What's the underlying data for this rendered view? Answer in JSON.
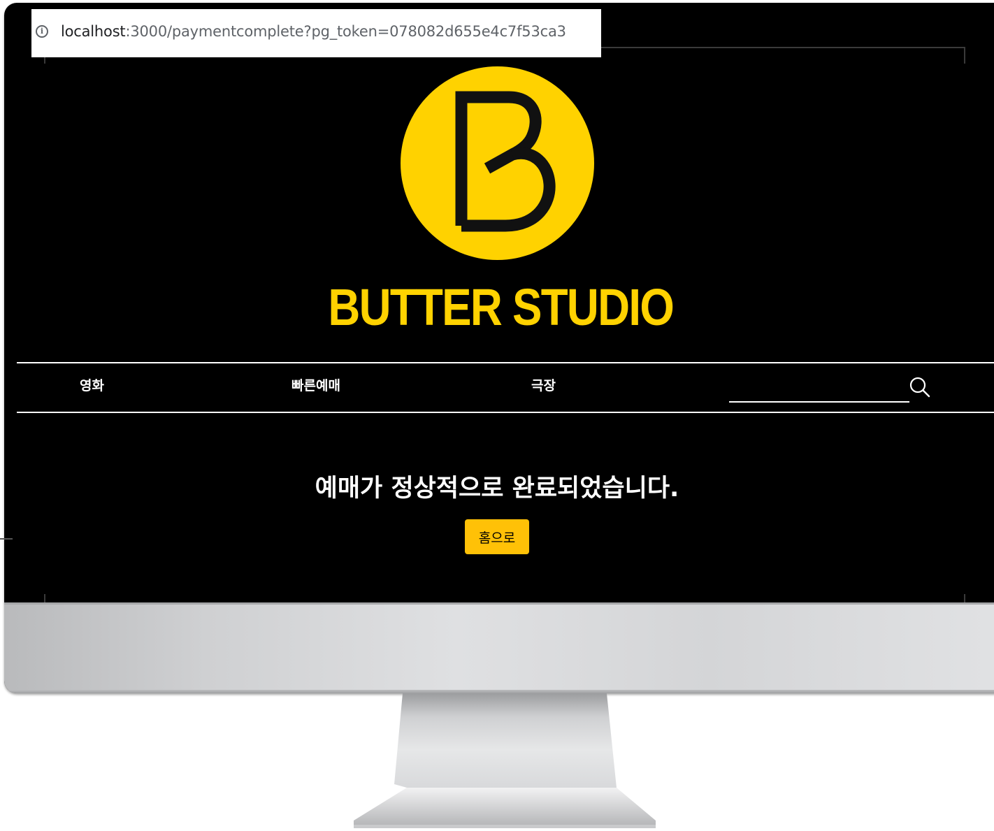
{
  "browser": {
    "url_host": "localhost",
    "url_rest": ":3000/paymentcomplete?pg_token=078082d655e4c7f53ca3"
  },
  "header": {
    "brand": "BUTTER STUDIO",
    "logo_letter": "B"
  },
  "nav": {
    "items": [
      {
        "label": "영화"
      },
      {
        "label": "빠른예매"
      },
      {
        "label": "극장"
      }
    ],
    "search_placeholder": ""
  },
  "main": {
    "message": "예매가 정상적으로 완료되었습니다.",
    "home_button": "홈으로"
  },
  "colors": {
    "background": "#000000",
    "brand_yellow": "#ffd200",
    "button_yellow": "#ffc107",
    "text": "#ffffff"
  },
  "icons": {
    "info": "info-icon",
    "search": "search-icon",
    "logo": "butter-studio-logo"
  }
}
